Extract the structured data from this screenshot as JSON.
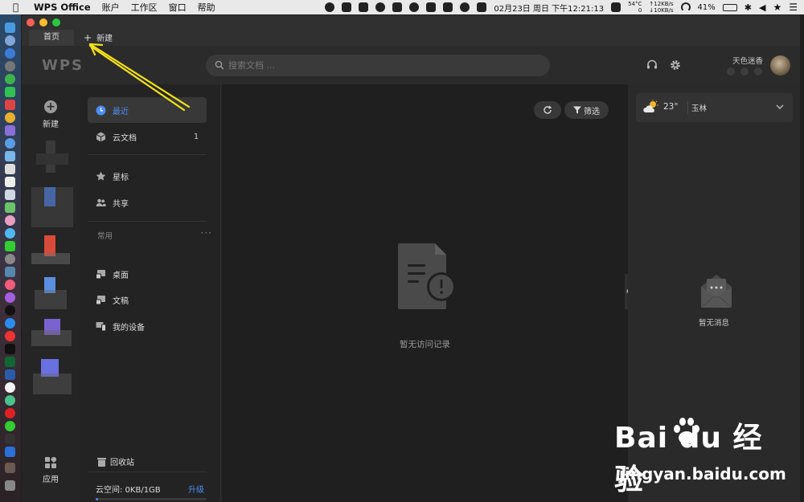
{
  "menubar": {
    "app_name": "WPS Office",
    "menus": [
      "账户",
      "工作区",
      "窗口",
      "帮助"
    ],
    "cpu_temp": "54°C",
    "cpu_val": "0",
    "net_up": "↑12KB/s",
    "net_down": "↓10KB/s",
    "datetime": "02月23日 周日 下午12:21:13",
    "battery": "41%"
  },
  "tabs": {
    "home": "首页",
    "new_tab": "新建"
  },
  "topbar": {
    "logo": "WPS",
    "search_placeholder": "搜索文档 ...",
    "username": "天色迷香"
  },
  "rail": {
    "new_label": "新建",
    "apps_label": "应用"
  },
  "nav": {
    "recent": "最近",
    "cloud_docs": "云文档",
    "cloud_docs_count": "1",
    "starred": "星标",
    "shared": "共享",
    "common_section": "常用",
    "more": "···",
    "desktop": "桌面",
    "documents": "文稿",
    "my_devices": "我的设备",
    "recycle_bin": "回收站",
    "cloud_space": "云空间: 0KB/1GB",
    "upgrade": "升级",
    "cloud_usage_fraction": 0.02
  },
  "main": {
    "filter_label": "筛选",
    "empty_text": "暂无访问记录"
  },
  "right_panel": {
    "temperature": "23°",
    "city": "玉林",
    "no_messages": "暂无消息"
  },
  "watermark": {
    "brand": "Bai du 经验",
    "url": "jingyan.baidu.com"
  },
  "colors": {
    "accent": "#4c8cf5",
    "annotation": "#f2e01a"
  }
}
